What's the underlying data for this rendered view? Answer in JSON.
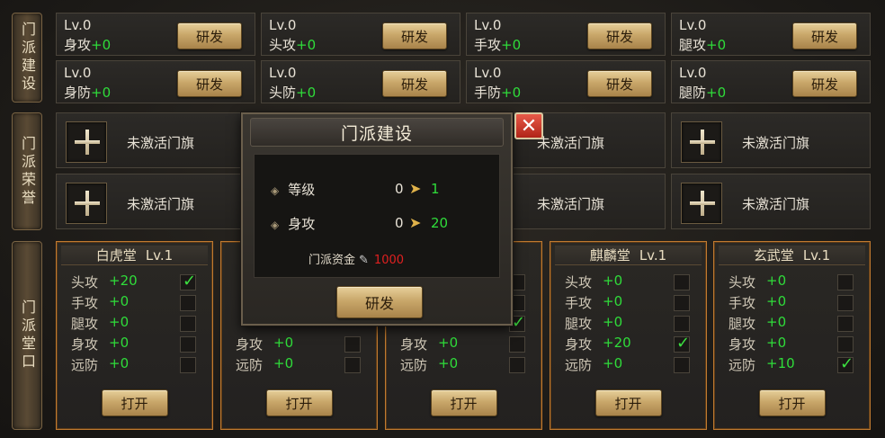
{
  "labels": {
    "build": "门派建设",
    "honor": "门派荣誉",
    "hall": "门派堂口"
  },
  "research_label": "研发",
  "attr_row1": [
    {
      "level": "Lv.0",
      "stat": "身攻",
      "value": "+0"
    },
    {
      "level": "Lv.0",
      "stat": "头攻",
      "value": "+0"
    },
    {
      "level": "Lv.0",
      "stat": "手攻",
      "value": "+0"
    },
    {
      "level": "Lv.0",
      "stat": "腿攻",
      "value": "+0"
    }
  ],
  "attr_row2": [
    {
      "level": "Lv.0",
      "stat": "身防",
      "value": "+0"
    },
    {
      "level": "Lv.0",
      "stat": "头防",
      "value": "+0"
    },
    {
      "level": "Lv.0",
      "stat": "手防",
      "value": "+0"
    },
    {
      "level": "Lv.0",
      "stat": "腿防",
      "value": "+0"
    }
  ],
  "flag_text": "未激活门旗",
  "halls": [
    {
      "name": "白虎堂",
      "level": "Lv.1",
      "rows": [
        {
          "stat": "头攻",
          "value": "+20",
          "checked": true
        },
        {
          "stat": "手攻",
          "value": "+0",
          "checked": false
        },
        {
          "stat": "腿攻",
          "value": "+0",
          "checked": false
        },
        {
          "stat": "身攻",
          "value": "+0",
          "checked": false
        },
        {
          "stat": "远防",
          "value": "+0",
          "checked": false
        }
      ]
    },
    {
      "name": "",
      "level": "",
      "rows": [
        {
          "stat": "",
          "value": "",
          "checked": false
        },
        {
          "stat": "",
          "value": "",
          "checked": false
        },
        {
          "stat": "",
          "value": "",
          "checked": false
        },
        {
          "stat": "身攻",
          "value": "+0",
          "checked": false
        },
        {
          "stat": "远防",
          "value": "+0",
          "checked": false
        }
      ]
    },
    {
      "name": "",
      "level": "",
      "rows": [
        {
          "stat": "",
          "value": "",
          "checked": false
        },
        {
          "stat": "",
          "value": "",
          "checked": false
        },
        {
          "stat": "",
          "value": "",
          "checked": true
        },
        {
          "stat": "身攻",
          "value": "+0",
          "checked": false
        },
        {
          "stat": "远防",
          "value": "+0",
          "checked": false
        }
      ]
    },
    {
      "name": "麒麟堂",
      "level": "Lv.1",
      "rows": [
        {
          "stat": "头攻",
          "value": "+0",
          "checked": false
        },
        {
          "stat": "手攻",
          "value": "+0",
          "checked": false
        },
        {
          "stat": "腿攻",
          "value": "+0",
          "checked": false
        },
        {
          "stat": "身攻",
          "value": "+20",
          "checked": true
        },
        {
          "stat": "远防",
          "value": "+0",
          "checked": false
        }
      ]
    },
    {
      "name": "玄武堂",
      "level": "Lv.1",
      "rows": [
        {
          "stat": "头攻",
          "value": "+0",
          "checked": false
        },
        {
          "stat": "手攻",
          "value": "+0",
          "checked": false
        },
        {
          "stat": "腿攻",
          "value": "+0",
          "checked": false
        },
        {
          "stat": "身攻",
          "value": "+0",
          "checked": false
        },
        {
          "stat": "远防",
          "value": "+10",
          "checked": true
        }
      ]
    }
  ],
  "open_label": "打开",
  "modal": {
    "title": "门派建设",
    "level_label": "等级",
    "level_from": "0",
    "level_to": "1",
    "stat_label": "身攻",
    "stat_from": "0",
    "stat_to": "20",
    "fund_label": "门派资金",
    "fund_cost": "1000",
    "button": "研发",
    "close": "✕"
  },
  "colors": {
    "green": "#2fdc3a",
    "cost_red": "#e02020",
    "hall_border": "#c07a30"
  }
}
